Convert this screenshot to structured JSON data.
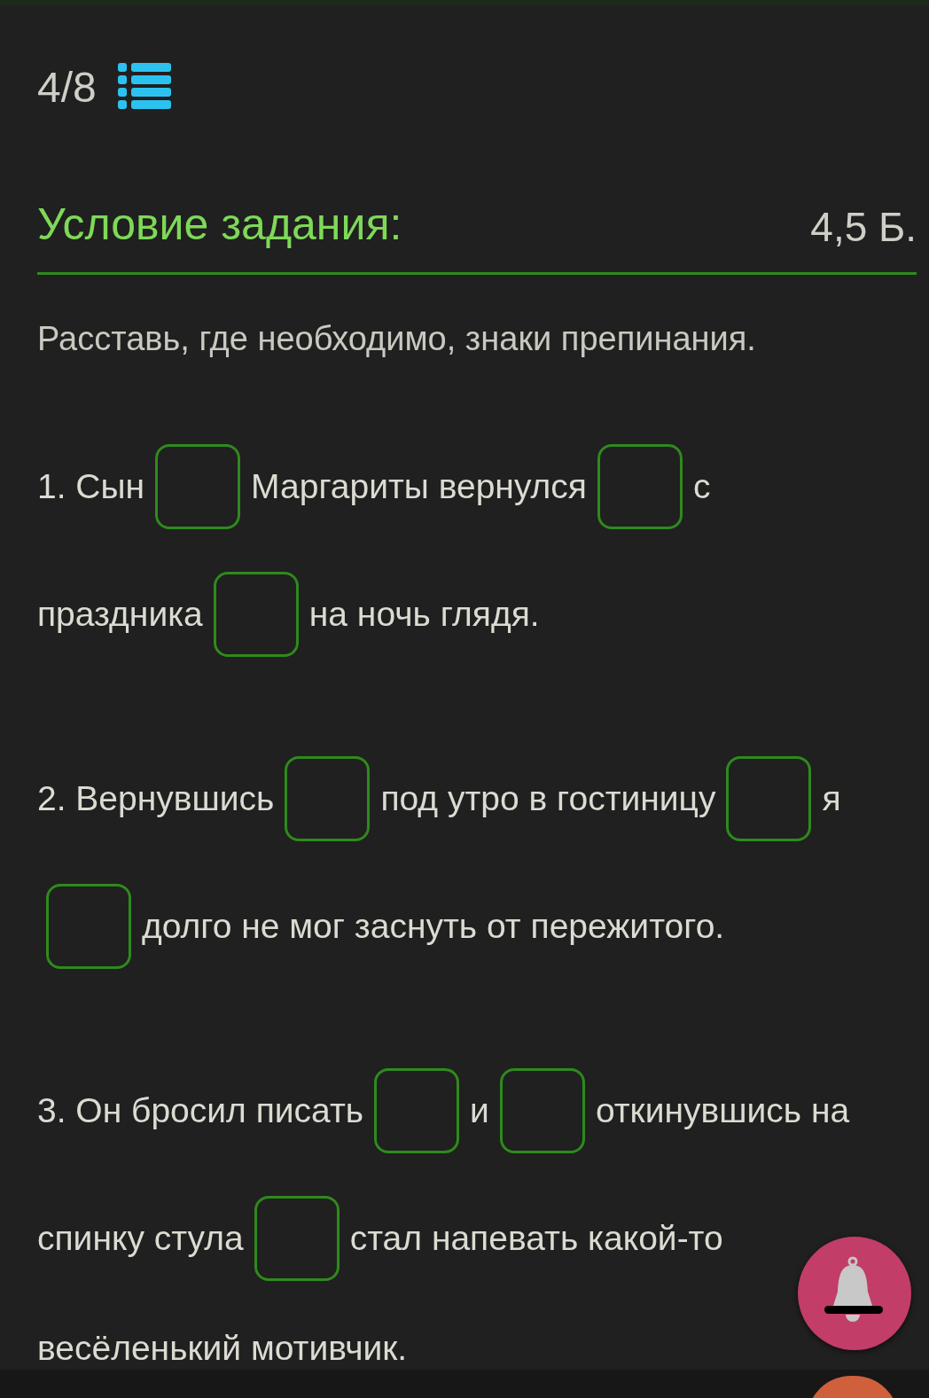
{
  "counter": "4/8",
  "task": {
    "title": "Условие задания:",
    "points": "4,5 Б."
  },
  "instruction": "Расставь, где необходимо, знаки препинания.",
  "items": [
    {
      "lines": [
        [
          {
            "kind": "text",
            "text": "1. Сын"
          },
          {
            "kind": "blank"
          },
          {
            "kind": "text",
            "text": "Маргариты вернулся"
          },
          {
            "kind": "blank"
          },
          {
            "kind": "text",
            "text": "с"
          }
        ],
        [
          {
            "kind": "text",
            "text": "праздника"
          },
          {
            "kind": "blank"
          },
          {
            "kind": "text",
            "text": "на ночь глядя."
          }
        ]
      ]
    },
    {
      "lines": [
        [
          {
            "kind": "text",
            "text": "2. Вернувшись"
          },
          {
            "kind": "blank"
          },
          {
            "kind": "text",
            "text": "под утро в гостиницу"
          },
          {
            "kind": "blank"
          },
          {
            "kind": "text",
            "text": "я"
          }
        ],
        [
          {
            "kind": "blank"
          },
          {
            "kind": "text",
            "text": "долго не мог заснуть от пережитого."
          }
        ]
      ]
    },
    {
      "lines": [
        [
          {
            "kind": "text",
            "text": "3. Он бросил писать"
          },
          {
            "kind": "blank"
          },
          {
            "kind": "text",
            "text": "и"
          },
          {
            "kind": "blank"
          },
          {
            "kind": "text",
            "text": "откинувшись на"
          }
        ],
        [
          {
            "kind": "text",
            "text": "спинку стула"
          },
          {
            "kind": "blank"
          },
          {
            "kind": "text",
            "text": "стал напевать какой-то"
          }
        ],
        [
          {
            "kind": "text",
            "text": "весёленький мотивчик."
          }
        ]
      ]
    }
  ]
}
